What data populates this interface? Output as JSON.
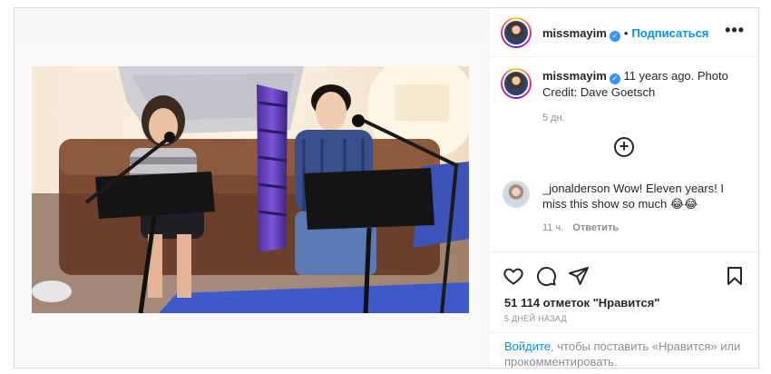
{
  "post": {
    "author": "missmayim",
    "follow_label": "Подписаться",
    "more_label": "•••"
  },
  "caption": {
    "author": "missmayim",
    "text": "11 years ago. Photo Credit: Dave Goetsch",
    "time": "5 дн."
  },
  "comment": {
    "author": "_jonalderson",
    "text": "Wow! Eleven years! I miss this show so much 😂😂",
    "time": "11 ч.",
    "reply_label": "Ответить"
  },
  "actions": {
    "likes": "51 114 отметок \"Нравится\"",
    "ago": "5 ДНЕЙ НАЗАД",
    "login_link": "Войдите",
    "login_text": ", чтобы поставить «Нравится» или прокомментировать."
  }
}
